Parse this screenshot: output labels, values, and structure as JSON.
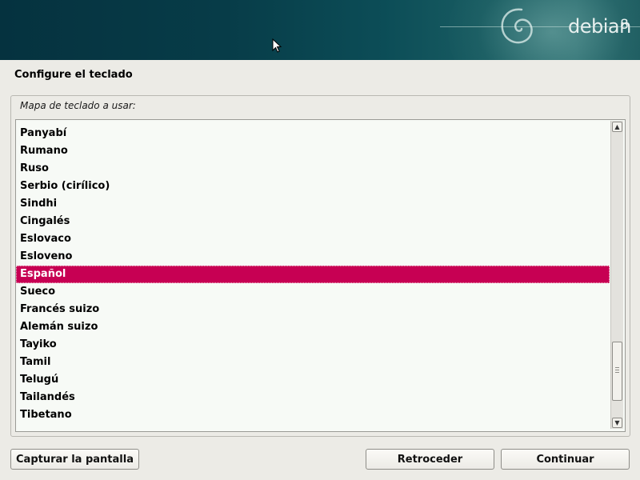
{
  "header": {
    "brand": "debian",
    "version": "8",
    "logo_icon": "debian-swirl-icon"
  },
  "page": {
    "title": "Configure el teclado"
  },
  "keymap": {
    "label": "Mapa de teclado a usar:",
    "items": [
      "Panyabí",
      "Rumano",
      "Ruso",
      "Serbio (cirílico)",
      "Sindhi",
      "Cingalés",
      "Eslovaco",
      "Esloveno",
      "Español",
      "Sueco",
      "Francés suizo",
      "Alemán suizo",
      "Tayiko",
      "Tamil",
      "Telugú",
      "Tailandés",
      "Tibetano"
    ],
    "selected": "Español",
    "selection_color": "#c70053"
  },
  "buttons": {
    "screenshot": "Capturar la pantalla",
    "back": "Retroceder",
    "continue": "Continuar"
  }
}
